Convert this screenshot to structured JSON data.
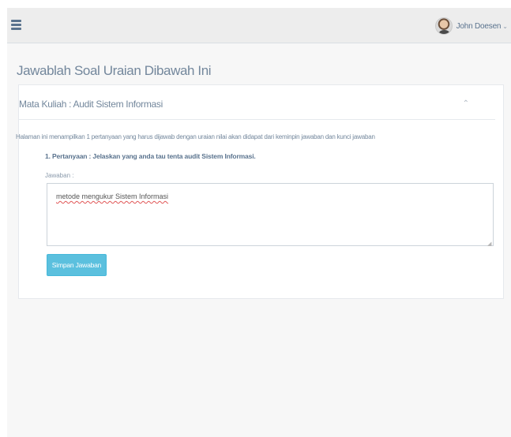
{
  "topbar": {
    "menu_icon": "hamburger-menu-icon",
    "user_name": "John Doesen",
    "user_caret": "⌄"
  },
  "page": {
    "title": "Jawablah Soal Uraian Dibawah Ini"
  },
  "panel": {
    "title": "Mata Kuliah : Audit Sistem Informasi",
    "collapse_icon": "chevron-up-icon",
    "collapse_glyph": "⌃",
    "intro": "Halaman ini menampilkan 1 pertanyaan yang harus dijawab dengan uraian nilai akan didapat dari keminpin jawaban dan kunci jawaban",
    "question": "1. Pertanyaan : Jelaskan yang anda tau tenta audit Sistem Informasi.",
    "answer_label": "Jawaban :",
    "answer_value": "metode  mengukur Sistem Informasi",
    "save_label": "Simpan Jawaban"
  },
  "colors": {
    "accent": "#5bc0de",
    "text": "#73879c",
    "topbar_bg": "#ededed",
    "page_bg": "#f7f7f7"
  }
}
